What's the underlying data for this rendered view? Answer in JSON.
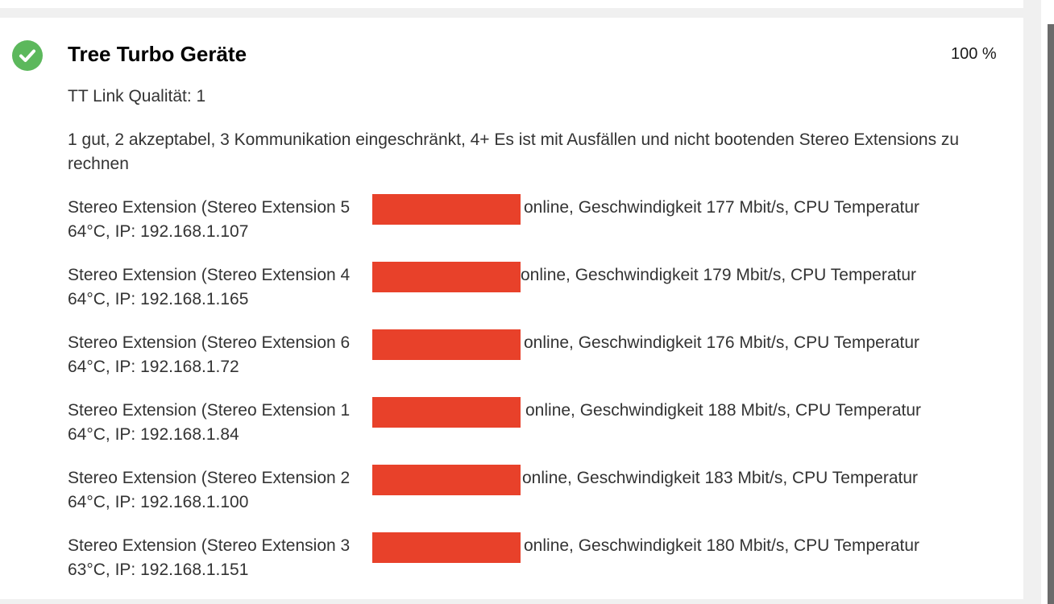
{
  "status": {
    "icon": "check-circle-icon",
    "color": "#5cb85c"
  },
  "title": "Tree Turbo Geräte",
  "progress": "100 %",
  "quality": "TT Link Qualität: 1",
  "legend": "1 gut, 2 akzeptabel, 3 Kommunikation eingeschränkt, 4+ Es ist mit Ausfällen und nicht bootenden Stereo Extensions zu rechnen",
  "redaction_color": "#e8412a",
  "devices": [
    {
      "prefix": "Stereo Extension (Stereo Extension 5",
      "status": "online, Geschwindigkeit 177 Mbit/s, CPU Temperatur",
      "detail": "64°C, IP: 192.168.1.107"
    },
    {
      "prefix": "Stereo Extension (Stereo Extension 4",
      "status": "online, Geschwindigkeit 179 Mbit/s, CPU Temperatur",
      "detail": "64°C, IP: 192.168.1.165"
    },
    {
      "prefix": "Stereo Extension (Stereo Extension 6",
      "status": "online, Geschwindigkeit 176 Mbit/s, CPU Temperatur",
      "detail": "64°C, IP: 192.168.1.72"
    },
    {
      "prefix": "Stereo Extension (Stereo Extension 1",
      "status": "online, Geschwindigkeit 188 Mbit/s, CPU Temperatur",
      "detail": "64°C, IP: 192.168.1.84"
    },
    {
      "prefix": "Stereo Extension (Stereo Extension 2",
      "status": "online, Geschwindigkeit 183 Mbit/s, CPU Temperatur",
      "detail": "64°C, IP: 192.168.1.100"
    },
    {
      "prefix": "Stereo Extension (Stereo Extension 3",
      "status": "online, Geschwindigkeit 180 Mbit/s, CPU Temperatur",
      "detail": "63°C, IP: 192.168.1.151"
    }
  ]
}
